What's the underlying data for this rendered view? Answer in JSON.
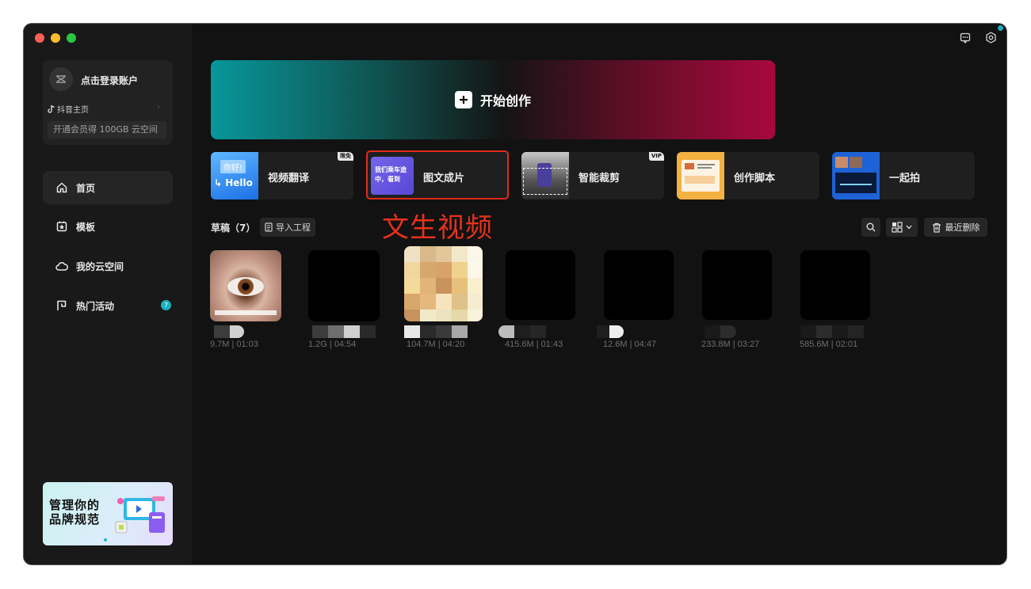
{
  "sidebar": {
    "account": {
      "login_text": "点击登录账户",
      "douyin_label": "抖音主页",
      "vip_text": "开通会员得 100GB 云空间"
    },
    "nav": [
      {
        "label": "首页",
        "icon": "home-icon",
        "active": true
      },
      {
        "label": "模板",
        "icon": "template-icon",
        "active": false
      },
      {
        "label": "我的云空间",
        "icon": "cloud-icon",
        "active": false
      },
      {
        "label": "热门活动",
        "icon": "flag-icon",
        "active": false,
        "badge": "7"
      }
    ],
    "promo": {
      "line1": "管理你的",
      "line2": "品牌规范"
    }
  },
  "hero": {
    "label": "开始创作"
  },
  "tools": [
    {
      "label": "视频翻译",
      "badge": "限免",
      "thumb_text_1": "你好!",
      "thumb_text_2": "Hello"
    },
    {
      "label": "图文成片",
      "thumb_text_1": "我们乘车途",
      "thumb_text_2": "中，看到"
    },
    {
      "label": "智能裁剪",
      "badge": "VIP"
    },
    {
      "label": "创作脚本"
    },
    {
      "label": "一起拍"
    }
  ],
  "annotation": "文生视频",
  "drafts": {
    "title": "草稿（7）",
    "import_label": "导入工程",
    "recent_delete_label": "最近删除",
    "items": [
      {
        "meta": "9.7M | 01:03"
      },
      {
        "meta": "1.2G | 04:54"
      },
      {
        "meta": "104.7M | 04:20"
      },
      {
        "meta": "415.6M | 01:43"
      },
      {
        "meta": "12.6M | 04:47"
      },
      {
        "meta": "233.8M | 03:27"
      },
      {
        "meta": "585.6M | 02:01"
      }
    ]
  },
  "colors": {
    "accent": "#1ab0c0",
    "annotation": "#e6311d",
    "hero_start": "#08979a",
    "hero_end": "#a8083e"
  }
}
